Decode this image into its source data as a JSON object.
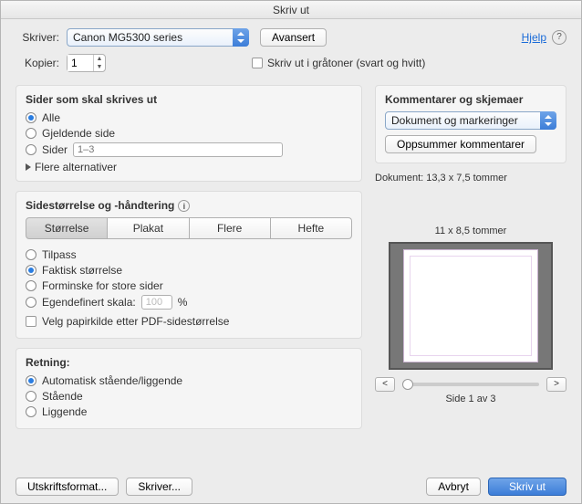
{
  "title": "Skriv ut",
  "top": {
    "printer_label": "Skriver:",
    "printer_value": "Canon MG5300 series",
    "advanced_btn": "Avansert",
    "help_link": "Hjelp",
    "copies_label": "Kopier:",
    "copies_value": "1",
    "grayscale_label": "Skriv ut i gråtoner (svart og hvitt)"
  },
  "pages": {
    "title": "Sider som skal skrives ut",
    "all": "Alle",
    "current": "Gjeldende side",
    "pages_label": "Sider",
    "pages_placeholder": "1–3",
    "more": "Flere alternativer"
  },
  "sizing": {
    "title": "Sidestørrelse og -håndtering",
    "tabs": {
      "size": "Størrelse",
      "poster": "Plakat",
      "multiple": "Flere",
      "booklet": "Hefte"
    },
    "fit": "Tilpass",
    "actual": "Faktisk størrelse",
    "shrink": "Forminske for store sider",
    "custom_label": "Egendefinert skala:",
    "custom_value": "100",
    "pct": "%",
    "choose_source": "Velg papirkilde etter PDF-sidestørrelse"
  },
  "orientation": {
    "title": "Retning:",
    "auto": "Automatisk stående/liggende",
    "portrait": "Stående",
    "landscape": "Liggende"
  },
  "comments": {
    "title": "Kommentarer og skjemaer",
    "value": "Dokument og markeringer",
    "summarize": "Oppsummer kommentarer"
  },
  "preview": {
    "doc_dims": "Dokument: 13,3 x 7,5 tommer",
    "paper_dims": "11 x 8,5 tommer",
    "page_of": "Side 1 av 3",
    "prev": "<",
    "next": ">"
  },
  "bottom": {
    "page_setup": "Utskriftsformat...",
    "printer_btn": "Skriver...",
    "cancel": "Avbryt",
    "print": "Skriv ut"
  }
}
